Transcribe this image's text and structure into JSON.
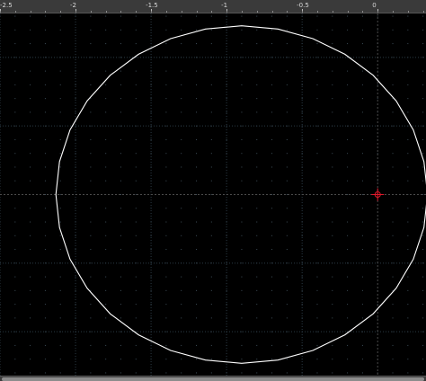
{
  "ruler": {
    "labels": [
      {
        "text": "-2.5",
        "value": -2.5
      },
      {
        "text": "-2",
        "value": -2
      },
      {
        "text": "-1.5",
        "value": -1.5
      },
      {
        "text": "-1",
        "value": -1
      },
      {
        "text": "-0.5",
        "value": -0.5
      },
      {
        "text": "0",
        "value": 0
      }
    ]
  },
  "viewport": {
    "x_range": [
      -2.5,
      0.32
    ],
    "y_range": [
      -1.32,
      1.32
    ],
    "grid_step": 0.5,
    "dot_step": 0.1
  },
  "drawing": {
    "circle": {
      "center_x": -0.9,
      "center_y": 0.0,
      "radius": 1.23,
      "segments": 32
    },
    "origin_marker": {
      "x": 0,
      "y": 0
    }
  },
  "colors": {
    "background": "#000000",
    "grid_line": "#2b3a44",
    "grid_dot": "#3d4d58",
    "axis_line": "#4a4a4a",
    "shape_stroke": "#ffffff",
    "origin_marker": "#e0182b"
  }
}
